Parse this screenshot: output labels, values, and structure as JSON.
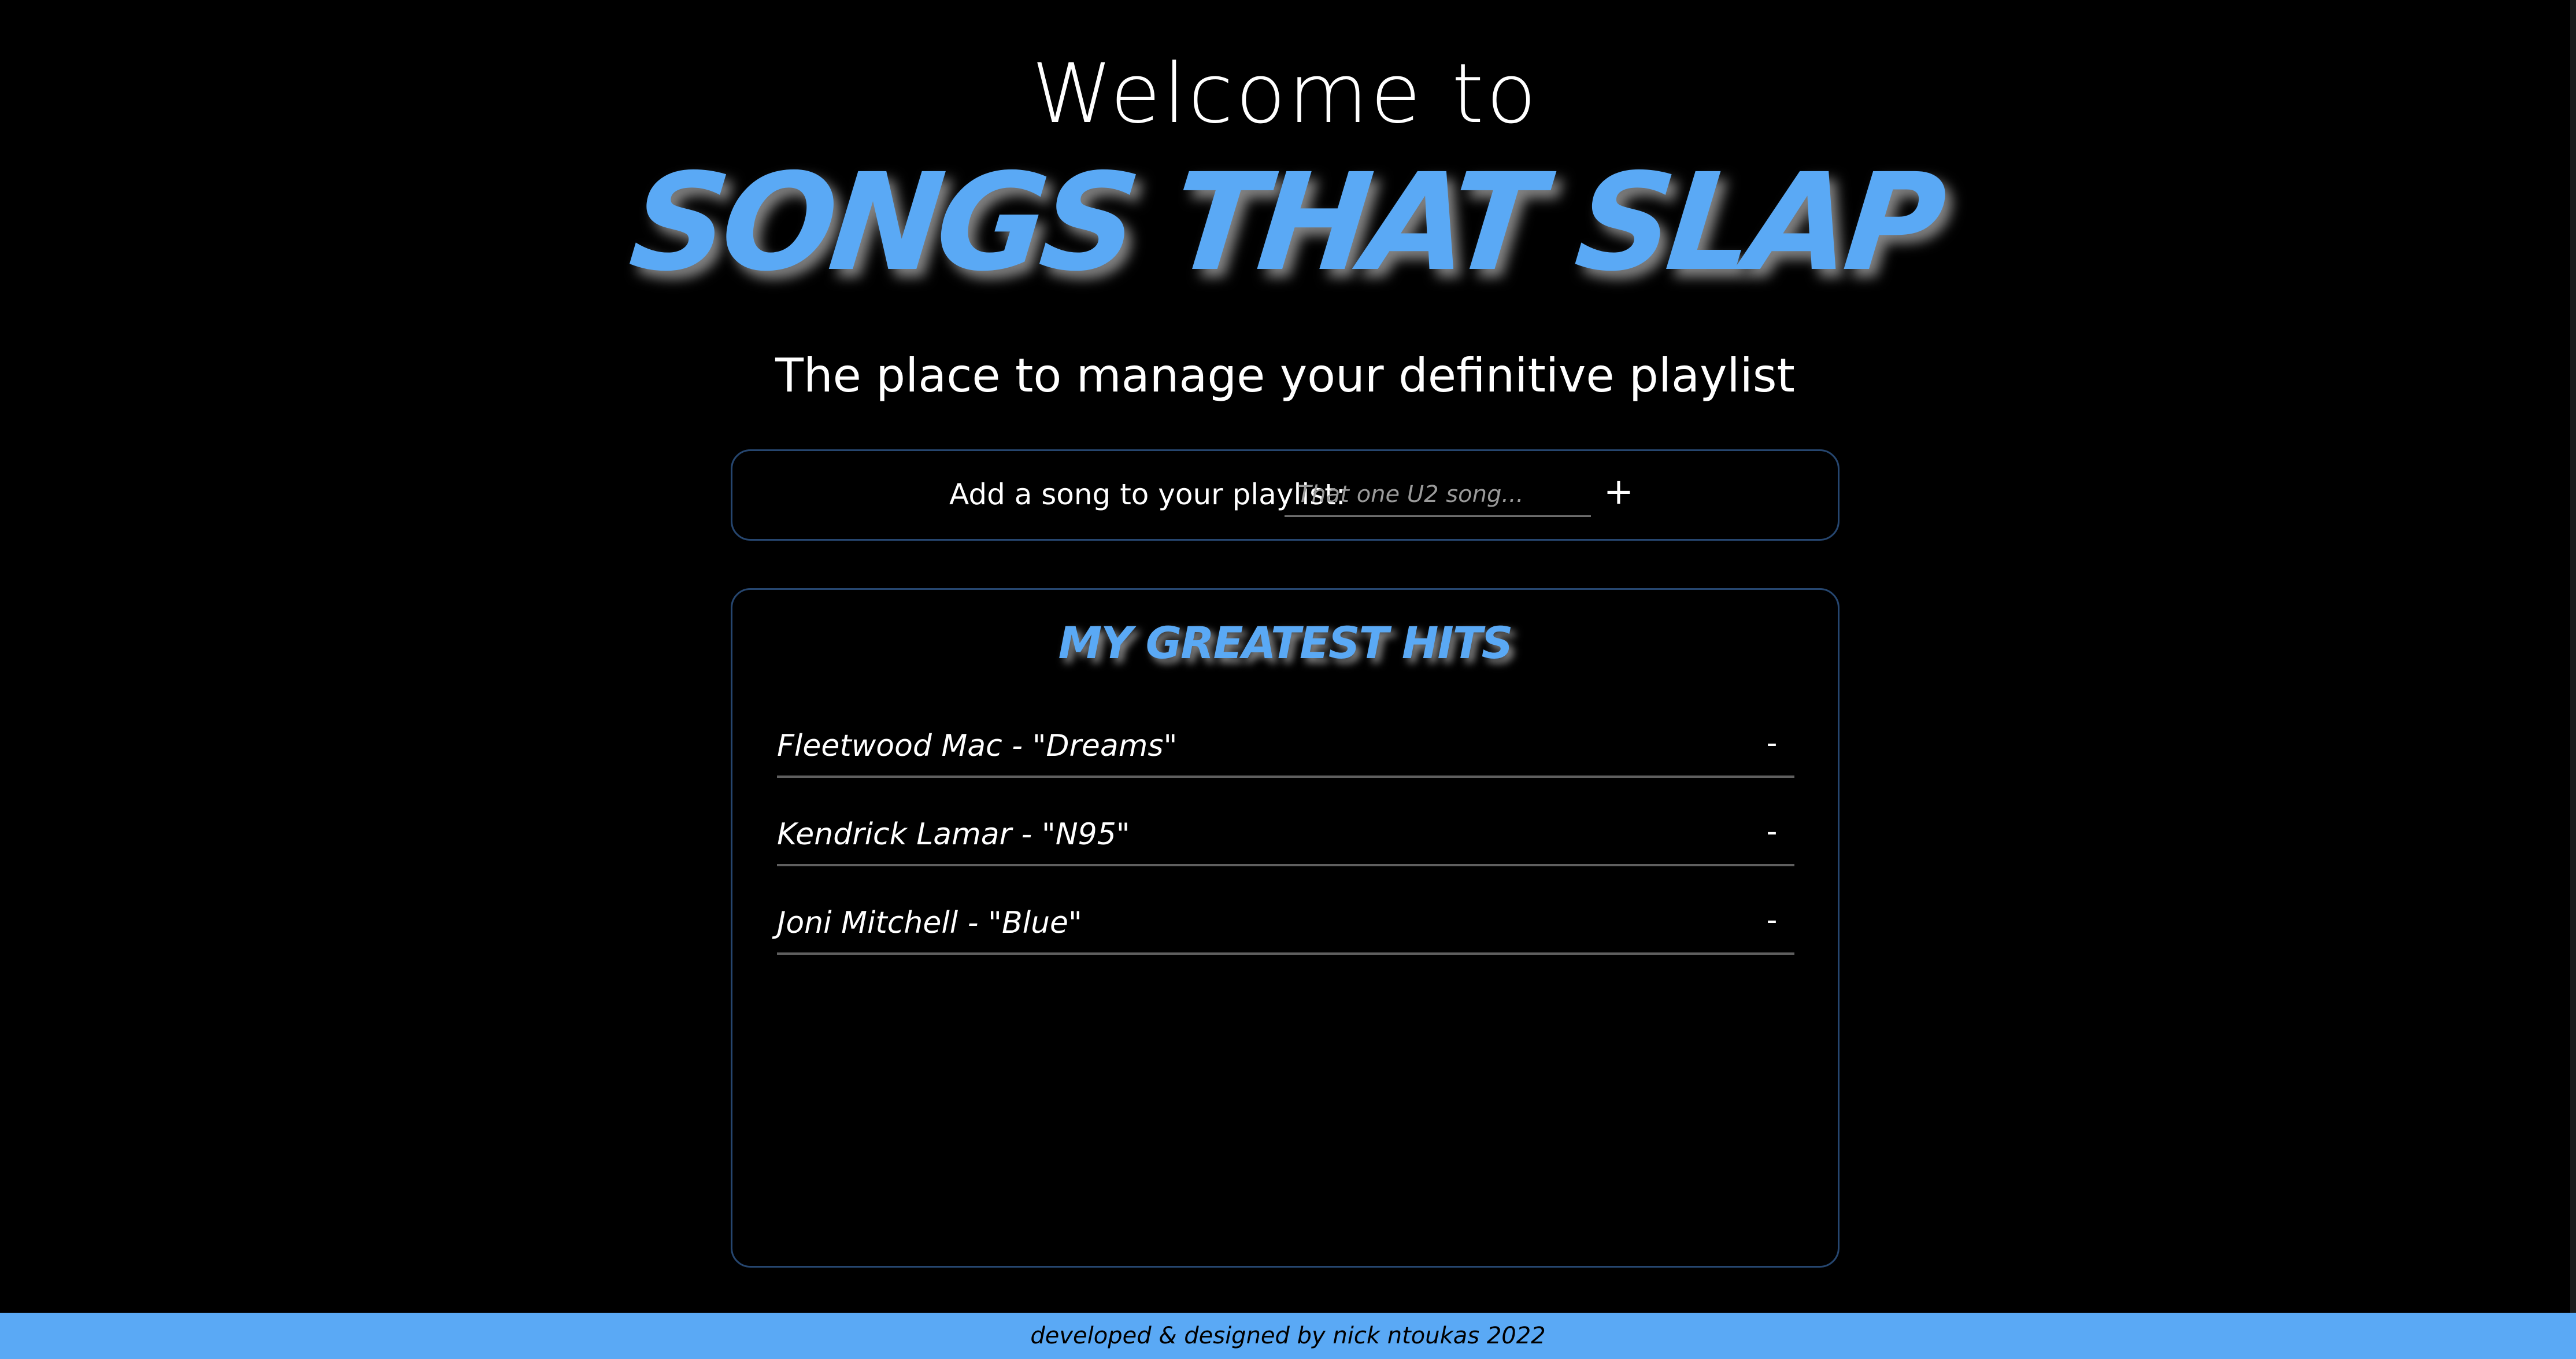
{
  "header": {
    "welcome": "Welcome to",
    "brand": "SONGS THAT SLAP",
    "tagline": "The place to manage your definitive playlist"
  },
  "add_song": {
    "label": "Add a song to your playlist:",
    "placeholder": "That one U2 song...",
    "value": "",
    "add_button": "+"
  },
  "playlist": {
    "title": "MY GREATEST HITS",
    "remove_label": "-",
    "songs": [
      {
        "text": "Fleetwood Mac - \"Dreams\""
      },
      {
        "text": "Kendrick Lamar - \"N95\""
      },
      {
        "text": "Joni Mitchell - \"Blue\""
      }
    ]
  },
  "footer": {
    "credit": "developed & designed by nick ntoukas 2022"
  },
  "colors": {
    "accent": "#5aa9f5",
    "background": "#000000",
    "border": "#26466f",
    "text": "#ffffff"
  }
}
